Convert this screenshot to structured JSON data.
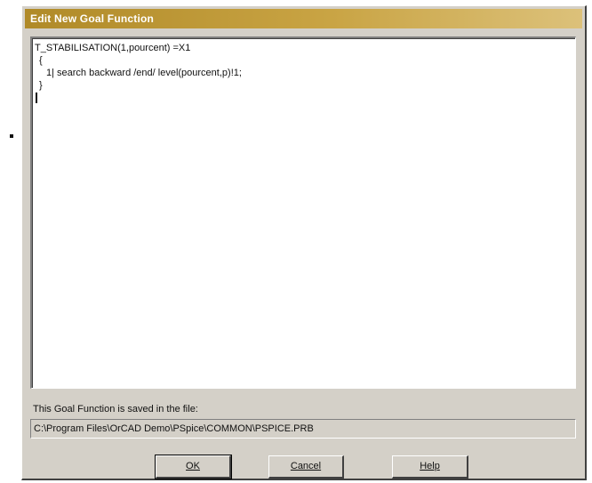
{
  "window": {
    "title": "Edit New Goal Function"
  },
  "editor": {
    "lines": [
      "T_STABILISATION(1,pourcent) =X1",
      "{",
      "1| search backward /end/ level(pourcent,p)!1;",
      "}"
    ]
  },
  "saved": {
    "label": "This Goal Function is saved in the file:",
    "path": "C:\\Program Files\\OrCAD Demo\\PSpice\\COMMON\\PSPICE.PRB"
  },
  "buttons": {
    "ok": "OK",
    "cancel": "Cancel",
    "help": "Help"
  }
}
